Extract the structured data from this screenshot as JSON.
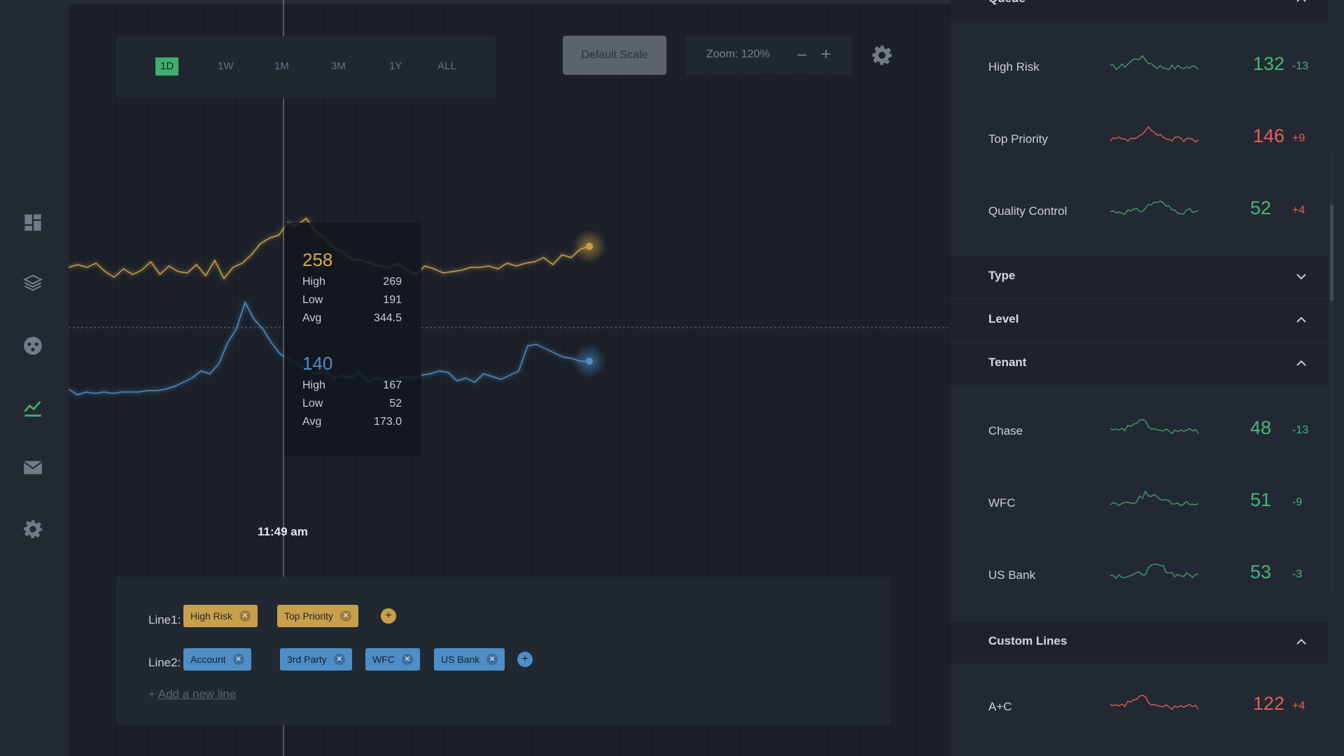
{
  "nav": {
    "icons": [
      "dashboard-icon",
      "layers-icon",
      "palette-icon",
      "chart-line-icon",
      "mail-icon",
      "gear-icon"
    ],
    "active": "chart-line-icon"
  },
  "toolbar": {
    "ranges": [
      "1D",
      "1W",
      "1M",
      "3M",
      "1Y",
      "ALL"
    ],
    "active_range": "1D",
    "default_scale_label": "Default Scale",
    "zoom_label": "Zoom: 120%",
    "zoom_out": "–",
    "zoom_in": "+"
  },
  "tooltip": {
    "series1": {
      "value": "258",
      "high_label": "High",
      "high": "269",
      "low_label": "Low",
      "low": "191",
      "avg_label": "Avg",
      "avg": "344.5"
    },
    "series2": {
      "value": "140",
      "high_label": "High",
      "high": "167",
      "low_label": "Low",
      "low": "52",
      "avg_label": "Avg",
      "avg": "173.0"
    }
  },
  "crosshair_time": "11:49 am",
  "chart_data": {
    "type": "line",
    "series": [
      {
        "color": "#c8a04c",
        "values": [
          382,
          378,
          382,
          376,
          388,
          396,
          384,
          392,
          386,
          374,
          392,
          380,
          388,
          390,
          378,
          394,
          372,
          398,
          382,
          376,
          364,
          348,
          340,
          336,
          318,
          322,
          312,
          330,
          340,
          354,
          360,
          370,
          372,
          376,
          380,
          382,
          376,
          386,
          392,
          380,
          384,
          390,
          388,
          386,
          382,
          382,
          380,
          384,
          376,
          380,
          376,
          374,
          368,
          378,
          364,
          368,
          356,
          352
        ]
      },
      {
        "color": "#4e8ec7",
        "values": [
          556,
          564,
          560,
          562,
          560,
          562,
          560,
          560,
          560,
          558,
          558,
          556,
          552,
          546,
          540,
          530,
          534,
          520,
          490,
          470,
          432,
          456,
          470,
          490,
          506,
          514,
          520,
          528,
          534,
          530,
          540,
          536,
          540,
          532,
          546,
          540,
          544,
          542,
          538,
          540,
          536,
          534,
          530,
          532,
          544,
          540,
          546,
          534,
          538,
          542,
          536,
          530,
          494,
          492,
          498,
          504,
          510,
          512,
          516,
          516
        ]
      }
    ]
  },
  "lines": {
    "line1_label": "Line1:",
    "line1_tags": [
      "High Risk",
      "Top Priority"
    ],
    "line2_label": "Line2:",
    "line2_tags": [
      "Account",
      "3rd Party",
      "WFC",
      "US Bank"
    ],
    "add_prefix": "+",
    "add_new_line": "Add a new line"
  },
  "panel": {
    "queue_title": "Queue",
    "queue_items": [
      {
        "label": "High Risk",
        "value": "132",
        "delta": "-13",
        "value_color": "green",
        "delta_color": "green"
      },
      {
        "label": "Top Priority",
        "value": "146",
        "delta": "+9",
        "value_color": "red",
        "delta_color": "red"
      },
      {
        "label": "Quality Control",
        "value": "52",
        "delta": "+4",
        "value_color": "green",
        "delta_color": "red"
      }
    ],
    "type_title": "Type",
    "level_title": "Level",
    "tenant_title": "Tenant",
    "tenant_items": [
      {
        "label": "Chase",
        "value": "48",
        "delta": "-13",
        "value_color": "green",
        "delta_color": "green"
      },
      {
        "label": "WFC",
        "value": "51",
        "delta": "-9",
        "value_color": "green",
        "delta_color": "green"
      },
      {
        "label": "US Bank",
        "value": "53",
        "delta": "-3",
        "value_color": "green",
        "delta_color": "green"
      }
    ],
    "custom_title": "Custom Lines",
    "custom_items": [
      {
        "label": "A+C",
        "value": "122",
        "delta": "+4",
        "value_color": "red",
        "delta_color": "red"
      }
    ]
  }
}
